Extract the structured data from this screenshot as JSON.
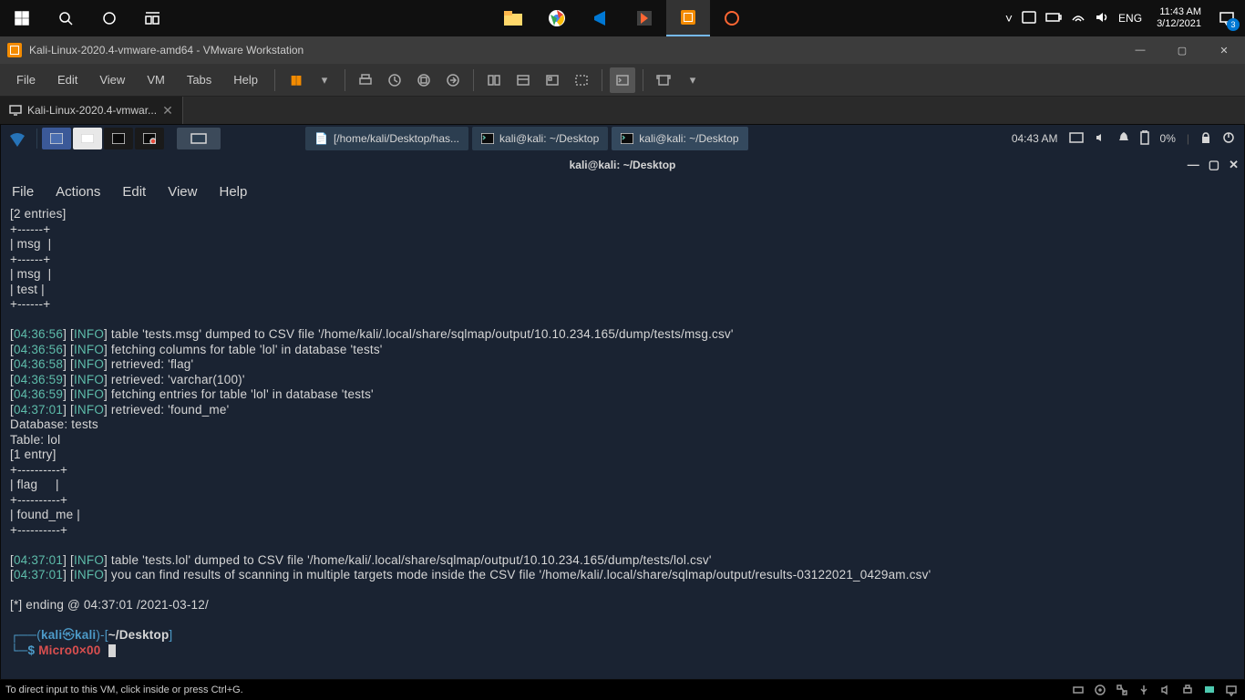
{
  "win_taskbar": {
    "tray_items": [
      "˅",
      "⎙",
      "📶",
      "🔊"
    ],
    "lang": "ENG",
    "time": "11:43 AM",
    "date": "3/12/2021",
    "notif_count": "3"
  },
  "vmware": {
    "title": "Kali-Linux-2020.4-vmware-amd64 - VMware Workstation",
    "menu": [
      "File",
      "Edit",
      "View",
      "VM",
      "Tabs",
      "Help"
    ],
    "tab": "Kali-Linux-2020.4-vmwar...",
    "status_hint": "To direct input to this VM, click inside or press Ctrl+G."
  },
  "kali_panel": {
    "tasks": [
      {
        "icon": "📄",
        "label": "[/home/kali/Desktop/has..."
      },
      {
        "icon": "▢",
        "label": "kali@kali: ~/Desktop"
      },
      {
        "icon": "▢",
        "label": "kali@kali: ~/Desktop",
        "active": true
      }
    ],
    "clock": "04:43 AM",
    "battery": "0%"
  },
  "terminal": {
    "title": "kali@kali: ~/Desktop",
    "menu": [
      "File",
      "Actions",
      "Edit",
      "View",
      "Help"
    ],
    "entries_header": "[2 entries]",
    "msg_header": "msg",
    "msg_rows": [
      "msg",
      "test"
    ],
    "log1": [
      {
        "t": "04:36:56",
        "lvl": "INFO",
        "msg_a": "table '",
        "q": "tests.msg",
        "msg_b": "' dumped to CSV file '",
        "path": "/home/kali/.local/share/sqlmap/output/10.10.234.165/dump/tests/msg.csv",
        "msg_c": "'"
      },
      {
        "t": "04:36:56",
        "lvl": "INFO",
        "msg_a": "fetching columns for table '",
        "q": "lol",
        "msg_b": "' in database '",
        "path": "tests",
        "msg_c": "'"
      },
      {
        "t": "04:36:58",
        "lvl": "INFO",
        "msg_a": "retrieved: '",
        "q": "flag",
        "msg_b": "'",
        "path": "",
        "msg_c": ""
      },
      {
        "t": "04:36:59",
        "lvl": "INFO",
        "msg_a": "retrieved: '",
        "q": "varchar(100)",
        "msg_b": "'",
        "path": "",
        "msg_c": ""
      },
      {
        "t": "04:36:59",
        "lvl": "INFO",
        "msg_a": "fetching entries for table '",
        "q": "lol",
        "msg_b": "' in database '",
        "path": "tests",
        "msg_c": "'"
      },
      {
        "t": "04:37:01",
        "lvl": "INFO",
        "msg_a": "retrieved: '",
        "q": "found_me",
        "msg_b": "'",
        "path": "",
        "msg_c": ""
      }
    ],
    "db_line": "Database: tests",
    "tbl_line": "Table: lol",
    "entry1": "[1 entry]",
    "flag_header": "flag",
    "flag_row": "found_me",
    "log2": [
      {
        "t": "04:37:01",
        "lvl": "INFO",
        "msg_a": "table '",
        "q": "tests.lol",
        "msg_b": "' dumped to CSV file '",
        "path": "/home/kali/.local/share/sqlmap/output/10.10.234.165/dump/tests/lol.csv",
        "msg_c": "'"
      },
      {
        "t": "04:37:01",
        "lvl": "INFO",
        "msg_a": "you can find results of scanning in multiple targets mode inside the CSV file '",
        "q": "",
        "msg_b": "",
        "path": "/home/kali/.local/share/sqlmap/output/results-03122021_0429am.csv",
        "msg_c": "'"
      }
    ],
    "ending": "[*] ending @ 04:37:01 /2021-03-12/",
    "prompt_user": "kali",
    "prompt_host": "kali",
    "prompt_path": "~/Desktop",
    "typed": "Micro0×00"
  }
}
